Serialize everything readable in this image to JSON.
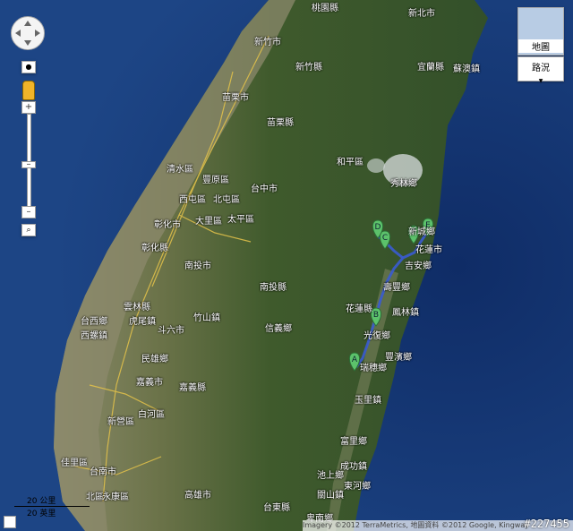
{
  "controls": {
    "map_type_button": "地圖",
    "traffic_button": "路況",
    "scale_km": "20 公里",
    "scale_mi": "20 英里"
  },
  "attribution": "Imagery ©2012 TerraMetrics, 地圖資料 ©2012 Google, Kingway",
  "watermark": "#227455",
  "places": [
    {
      "id": "taoyuan",
      "name": "桃園縣"
    },
    {
      "id": "xinbei",
      "name": "新北市"
    },
    {
      "id": "xinzhu_city",
      "name": "新竹市"
    },
    {
      "id": "xinzhu",
      "name": "新竹縣"
    },
    {
      "id": "yilan",
      "name": "宜蘭縣"
    },
    {
      "id": "sufang",
      "name": "蘇澳鎮"
    },
    {
      "id": "miaoli_city",
      "name": "苗栗市"
    },
    {
      "id": "miaoli",
      "name": "苗栗縣"
    },
    {
      "id": "heping",
      "name": "和平區"
    },
    {
      "id": "xiulin",
      "name": "秀林鄉"
    },
    {
      "id": "qingshui",
      "name": "清水區"
    },
    {
      "id": "fengyuan",
      "name": "豐原區"
    },
    {
      "id": "xitun",
      "name": "西屯區"
    },
    {
      "id": "beitun",
      "name": "北屯區"
    },
    {
      "id": "taizhong",
      "name": "台中市"
    },
    {
      "id": "changhua",
      "name": "彰化市"
    },
    {
      "id": "dali",
      "name": "大里區"
    },
    {
      "id": "taiping",
      "name": "太平區"
    },
    {
      "id": "changhua_county",
      "name": "彰化縣"
    },
    {
      "id": "nantou_city",
      "name": "南投市"
    },
    {
      "id": "xincheng",
      "name": "新城鄉"
    },
    {
      "id": "hualien",
      "name": "花蓮市"
    },
    {
      "id": "jian",
      "name": "吉安鄉"
    },
    {
      "id": "shoufeng",
      "name": "壽豐鄉"
    },
    {
      "id": "nantou",
      "name": "南投縣"
    },
    {
      "id": "hualien_county",
      "name": "花蓮縣"
    },
    {
      "id": "fenglin",
      "name": "鳳林鎮"
    },
    {
      "id": "yunlin",
      "name": "雲林縣"
    },
    {
      "id": "huwei",
      "name": "虎尾鎮"
    },
    {
      "id": "taixi",
      "name": "台西鄉"
    },
    {
      "id": "douliu",
      "name": "斗六市"
    },
    {
      "id": "zhushan",
      "name": "竹山鎮"
    },
    {
      "id": "xilou",
      "name": "西螺鎮"
    },
    {
      "id": "xinyi",
      "name": "信義鄉"
    },
    {
      "id": "guangfu",
      "name": "光復鄉"
    },
    {
      "id": "fengbin",
      "name": "豐濱鄉"
    },
    {
      "id": "minxiong",
      "name": "民雄鄉"
    },
    {
      "id": "ruisui",
      "name": "瑞穗鄉"
    },
    {
      "id": "chiayi_city",
      "name": "嘉義市"
    },
    {
      "id": "chiayi",
      "name": "嘉義縣"
    },
    {
      "id": "yuli",
      "name": "玉里鎮"
    },
    {
      "id": "baihe",
      "name": "白河區"
    },
    {
      "id": "xinying",
      "name": "新營區"
    },
    {
      "id": "jiali",
      "name": "佳里區"
    },
    {
      "id": "tainan",
      "name": "台南市"
    },
    {
      "id": "fuli",
      "name": "富里鄉"
    },
    {
      "id": "chenggong",
      "name": "成功鎮"
    },
    {
      "id": "chishang",
      "name": "池上鄉"
    },
    {
      "id": "guanshan",
      "name": "關山鎮"
    },
    {
      "id": "donghe",
      "name": "東河鄉"
    },
    {
      "id": "kaohsiung",
      "name": "高雄市"
    },
    {
      "id": "beiqu",
      "name": "北區"
    },
    {
      "id": "yongkang",
      "name": "永康區"
    },
    {
      "id": "taitung",
      "name": "台東縣"
    },
    {
      "id": "beinan",
      "name": "卑南鄉"
    }
  ],
  "markers": [
    {
      "label": "A"
    },
    {
      "label": "B"
    },
    {
      "label": "C"
    },
    {
      "label": "D"
    },
    {
      "label": "E"
    },
    {
      "label": "F"
    }
  ],
  "colors": {
    "sea": "#1a3f7a",
    "land": "#4b5e33",
    "route": "#3a5bd0",
    "marker": "#5cc26b"
  }
}
